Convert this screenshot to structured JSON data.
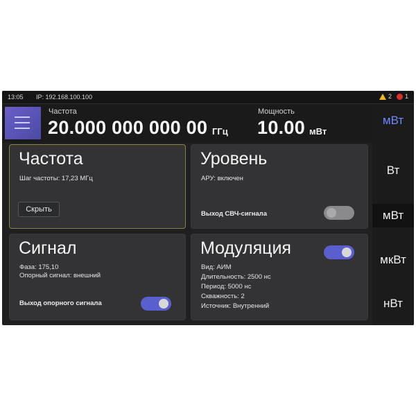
{
  "status": {
    "time": "13:05",
    "ip": "IP: 192.168.100.100",
    "warning_count": "2",
    "error_count": "1"
  },
  "header": {
    "freq_label": "Частота",
    "freq_value": "20.000 000 000 00",
    "freq_unit": "ГГц",
    "power_label": "Мощность",
    "power_value": "10.00",
    "power_unit": "мВт"
  },
  "units": {
    "top_active": "мВт",
    "items": [
      "Вт",
      "мВт",
      "мкВт",
      "нВт"
    ],
    "selected": "мВт"
  },
  "cards": {
    "frequency": {
      "title": "Частота",
      "step": "Шаг частоты: 17,23 МГц",
      "hide_button": "Скрыть"
    },
    "level": {
      "title": "Уровень",
      "agc": "АРУ: включен",
      "rf_output_label": "Выход СВЧ-сигнала",
      "rf_output_on": false
    },
    "signal": {
      "title": "Сигнал",
      "phase": "Фаза: 175,10",
      "ref": "Опорный сигнал: внешний",
      "ref_output_label": "Выход опорного сигнала",
      "ref_output_on": true
    },
    "modulation": {
      "title": "Модуляция",
      "enabled": true,
      "lines": [
        "Вид: АИМ",
        "Длительность: 2500 нс",
        "Период: 5000 нс",
        "Скважность: 2",
        "Источник: Внутренний"
      ]
    }
  },
  "colors": {
    "accent": "#5a5fcf",
    "active_unit": "#6e86ff",
    "highlight_border": "#8a8441",
    "warning": "#f0b429",
    "error": "#d9302c"
  }
}
